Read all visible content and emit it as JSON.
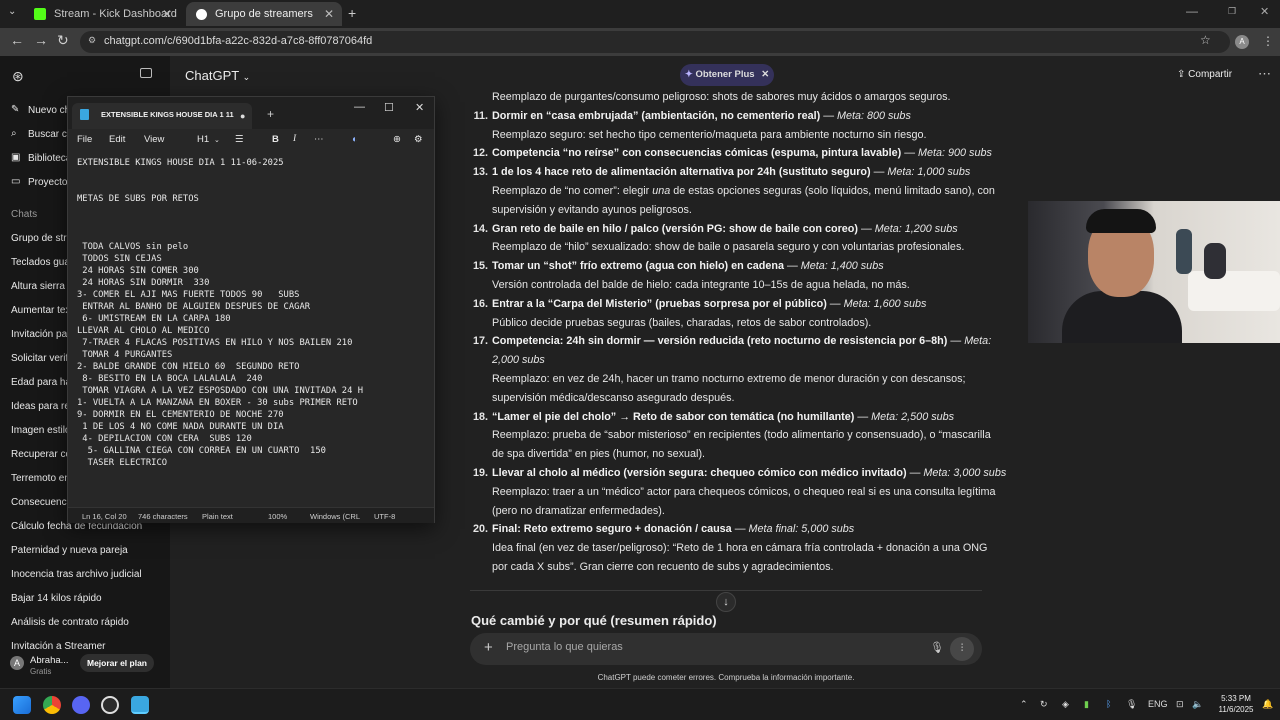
{
  "browser": {
    "tabs": [
      {
        "title": "Stream - Kick Dashboard",
        "icon": "kick-icon",
        "color": "#53fc18"
      },
      {
        "title": "Grupo de streamers",
        "icon": "chatgpt-icon"
      }
    ],
    "url": "chatgpt.com/c/690d1bfa-a22c-832d-a7c8-8ff0787064fd",
    "profile_initial": "A"
  },
  "chatgpt": {
    "model_label": "ChatGPT",
    "plus_label": "Obtener Plus",
    "share_label": "Compartir",
    "sidebar_top": [
      "Nuevo chat",
      "Buscar chats",
      "Biblioteca",
      "Proyectos"
    ],
    "chats_heading": "Chats",
    "chats": [
      "Grupo de streamers",
      "Teclados gua",
      "Altura sierra p",
      "Aumentar tex",
      "Invitación par",
      "Solicitar verifi",
      "Edad para hal",
      "Ideas para ret",
      "Imagen estilo",
      "Recuperar cor",
      "Terremoto en",
      "Consecuencia",
      "Cálculo fecha de fecundación",
      "Paternidad y nueva pareja",
      "Inocencia tras archivo judicial",
      "Bajar 14 kilos rápido",
      "Análisis de contrato rápido",
      "Invitación a Streamer"
    ],
    "user": {
      "name": "Abraha...",
      "plan": "Gratis",
      "initial": "A",
      "upgrade_label": "Mejorar el plan"
    },
    "section_heading": "Qué cambié y por qué (resumen rápido)",
    "input_placeholder": "Pregunta lo que quieras",
    "disclaimer": "ChatGPT puede cometer errores. Comprueba la información importante."
  },
  "notepad": {
    "tab_title": "EXTENSIBLE KINGS HOUSE DIA 1 11",
    "menu": [
      "File",
      "Edit",
      "View"
    ],
    "heading_style": "H1",
    "text": "EXTENSIBLE KINGS HOUSE DIA 1 11-06-2025\n\n\nMETAS DE SUBS POR RETOS\n\n\n\n TODA CALVOS sin pelo\n TODOS SIN CEJAS\n 24 HORAS SIN COMER 300\n 24 HORAS SIN DORMIR  330\n3- COMER EL AJI MAS FUERTE TODOS 90   SUBS\n ENTRAR AL BANHO DE ALGUIEN DESPUES DE CAGAR\n 6- UMISTREAM EN LA CARPA 180\nLLEVAR AL CHOLO AL MEDICO\n 7-TRAER 4 FLACAS POSITIVAS EN HILO Y NOS BAILEN 210\n TOMAR 4 PURGANTES\n2- BALDE GRANDE CON HIELO 60  SEGUNDO RETO\n 8- BESITO EN LA BOCA LALALALA  240\n TOMAR VIAGRA A LA VEZ ESPOSDADO CON UNA INVITADA 24 H\n1- VUELTA A LA MANZANA EN BOXER - 30 subs PRIMER RETO\n9- DORMIR EN EL CEMENTERIO DE NOCHE 270\n 1 DE LOS 4 NO COME NADA DURANTE UN DIA\n 4- DEPILACION CON CERA  SUBS 120\n  5- GALLINA CIEGA CON CORREA EN UN CUARTO  150\n  TASER ELECTRICO",
    "status": {
      "position": "Ln 16, Col 20",
      "chars": "746 characters",
      "format": "Plain text",
      "zoom": "100%",
      "eol": "Windows (CRL",
      "encoding": "UTF-8"
    }
  },
  "conversation": {
    "lines": [
      {
        "num": "",
        "segs": [
          {
            "t": "Reemplazo de purgantes/consumo peligroso: shots de sabores muy ácidos o amargos seguros.",
            "s": ""
          }
        ]
      },
      {
        "num": "11.",
        "segs": [
          {
            "t": "Dormir en “casa embrujada” (ambientación, no cementerio real)",
            "s": "b"
          },
          {
            "t": " — ",
            "s": ""
          },
          {
            "t": "Meta: 800 subs",
            "s": "i"
          }
        ]
      },
      {
        "num": "",
        "segs": [
          {
            "t": "Reemplazo seguro: set hecho tipo cementerio/maqueta para ambiente nocturno sin riesgo.",
            "s": ""
          }
        ]
      },
      {
        "num": "12.",
        "segs": [
          {
            "t": "Competencia “no reírse” con consecuencias cómicas (espuma, pintura lavable)",
            "s": "b"
          },
          {
            "t": " — ",
            "s": ""
          },
          {
            "t": "Meta: 900 subs",
            "s": "i"
          }
        ]
      },
      {
        "num": "13.",
        "segs": [
          {
            "t": "1 de los 4 hace reto de alimentación alternativa por 24h (sustituto seguro)",
            "s": "b"
          },
          {
            "t": " — ",
            "s": ""
          },
          {
            "t": "Meta: 1,000 subs",
            "s": "i"
          }
        ]
      },
      {
        "num": "",
        "segs": [
          {
            "t": "Reemplazo de “no comer”: elegir ",
            "s": ""
          },
          {
            "t": "una",
            "s": "i"
          },
          {
            "t": " de estas opciones seguras (solo líquidos, menú limitado sano), con",
            "s": ""
          }
        ]
      },
      {
        "num": "",
        "segs": [
          {
            "t": "supervisión y evitando ayunos peligrosos.",
            "s": ""
          }
        ]
      },
      {
        "num": "14.",
        "segs": [
          {
            "t": "Gran reto de baile en hilo / palco (versión PG: show de baile con coreo)",
            "s": "b"
          },
          {
            "t": " — ",
            "s": ""
          },
          {
            "t": "Meta: 1,200 subs",
            "s": "i"
          }
        ]
      },
      {
        "num": "",
        "segs": [
          {
            "t": "Reemplazo de “hilo” sexualizado: show de baile o pasarela seguro y con voluntarias profesionales.",
            "s": ""
          }
        ]
      },
      {
        "num": "15.",
        "segs": [
          {
            "t": "Tomar un “shot” frío extremo (agua con hielo) en cadena",
            "s": "b"
          },
          {
            "t": " — ",
            "s": ""
          },
          {
            "t": "Meta: 1,400 subs",
            "s": "i"
          }
        ]
      },
      {
        "num": "",
        "segs": [
          {
            "t": "Versión controlada del balde de hielo: cada integrante 10–15s de agua helada, no más.",
            "s": ""
          }
        ]
      },
      {
        "num": "16.",
        "segs": [
          {
            "t": "Entrar a la “Carpa del Misterio” (pruebas sorpresa por el público)",
            "s": "b"
          },
          {
            "t": " — ",
            "s": ""
          },
          {
            "t": "Meta: 1,600 subs",
            "s": "i"
          }
        ]
      },
      {
        "num": "",
        "segs": [
          {
            "t": "Público decide pruebas seguras (bailes, charadas, retos de sabor controlados).",
            "s": ""
          }
        ]
      },
      {
        "num": "17.",
        "segs": [
          {
            "t": "Competencia: 24h sin dormir — versión reducida (reto nocturno de resistencia por 6–8h)",
            "s": "b"
          },
          {
            "t": " — ",
            "s": ""
          },
          {
            "t": "Meta:",
            "s": "i"
          }
        ]
      },
      {
        "num": "",
        "segs": [
          {
            "t": "2,000 subs",
            "s": "i"
          }
        ]
      },
      {
        "num": "",
        "segs": [
          {
            "t": "Reemplazo: en vez de 24h, hacer un tramo nocturno extremo de menor duración y con descansos;",
            "s": ""
          }
        ]
      },
      {
        "num": "",
        "segs": [
          {
            "t": "supervisión médica/descanso asegurado después.",
            "s": ""
          }
        ]
      },
      {
        "num": "18.",
        "segs": [
          {
            "t": "“Lamer el pie del cholo” → Reto de sabor con temática (no humillante)",
            "s": "b"
          },
          {
            "t": " — ",
            "s": ""
          },
          {
            "t": "Meta: 2,500 subs",
            "s": "i"
          }
        ]
      },
      {
        "num": "",
        "segs": [
          {
            "t": "Reemplazo: prueba de “sabor misterioso” en recipientes (todo alimentario y consensuado), o “mascarilla",
            "s": ""
          }
        ]
      },
      {
        "num": "",
        "segs": [
          {
            "t": "de spa divertida” en pies (humor, no sexual).",
            "s": ""
          }
        ]
      },
      {
        "num": "19.",
        "segs": [
          {
            "t": "Llevar al cholo al médico (versión segura: chequeo cómico con médico invitado)",
            "s": "b"
          },
          {
            "t": " — ",
            "s": ""
          },
          {
            "t": "Meta: 3,000 subs",
            "s": "i"
          }
        ]
      },
      {
        "num": "",
        "segs": [
          {
            "t": "Reemplazo: traer a un “médico” actor para chequeos cómicos, o chequeo real si es una consulta legítima",
            "s": ""
          }
        ]
      },
      {
        "num": "",
        "segs": [
          {
            "t": "(pero no dramatizar enfermedades).",
            "s": ""
          }
        ]
      },
      {
        "num": "20.",
        "segs": [
          {
            "t": "Final: Reto extremo seguro + donación / causa",
            "s": "b"
          },
          {
            "t": " — ",
            "s": ""
          },
          {
            "t": "Meta final: 5,000 subs",
            "s": "i"
          }
        ]
      },
      {
        "num": "",
        "segs": [
          {
            "t": "Idea final (en vez de taser/peligroso): “Reto de 1 hora en cámara fría controlada + donación a una ONG",
            "s": ""
          }
        ]
      },
      {
        "num": "",
        "segs": [
          {
            "t": "por cada X subs”. Gran cierre con recuento de subs y agradecimientos.",
            "s": ""
          }
        ]
      }
    ]
  },
  "taskbar": {
    "language": "ENG",
    "time": "5:33 PM",
    "date": "11/6/2025"
  },
  "colors": {
    "accent_plus": "#6a5cff",
    "kick_green": "#53fc18"
  }
}
